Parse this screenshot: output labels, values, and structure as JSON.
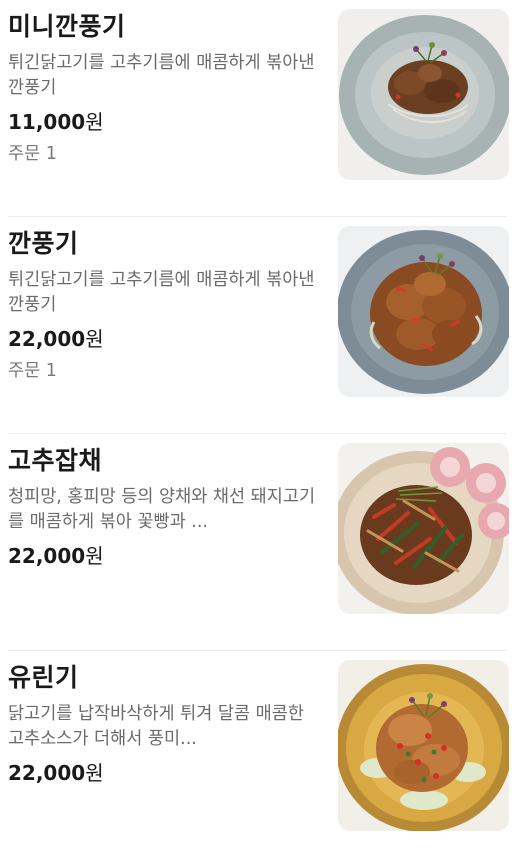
{
  "menu": {
    "items": [
      {
        "name": "미니깐풍기",
        "description": "튀긴닭고기를 고추기름에 매콤하게 볶아낸 깐풍기",
        "price": "11,000",
        "currency": "원",
        "orders": "주문 1",
        "image_icon": "food-photo-icon"
      },
      {
        "name": "깐풍기",
        "description": "튀긴닭고기를 고추기름에 매콤하게 볶아낸 깐풍기",
        "price": "22,000",
        "currency": "원",
        "orders": "주문 1",
        "image_icon": "food-photo-icon"
      },
      {
        "name": "고추잡채",
        "description": "청피망, 홍피망 등의 양채와 채선 돼지고기를 매콤하게 볶아 꽃빵과 ...",
        "price": "22,000",
        "currency": "원",
        "image_icon": "food-photo-icon"
      },
      {
        "name": "유린기",
        "description": "닭고기를 납작바삭하게 튀겨 달콤 매콤한 고추소스가 더해서 풍미...",
        "price": "22,000",
        "currency": "원",
        "image_icon": "food-photo-icon"
      }
    ]
  }
}
